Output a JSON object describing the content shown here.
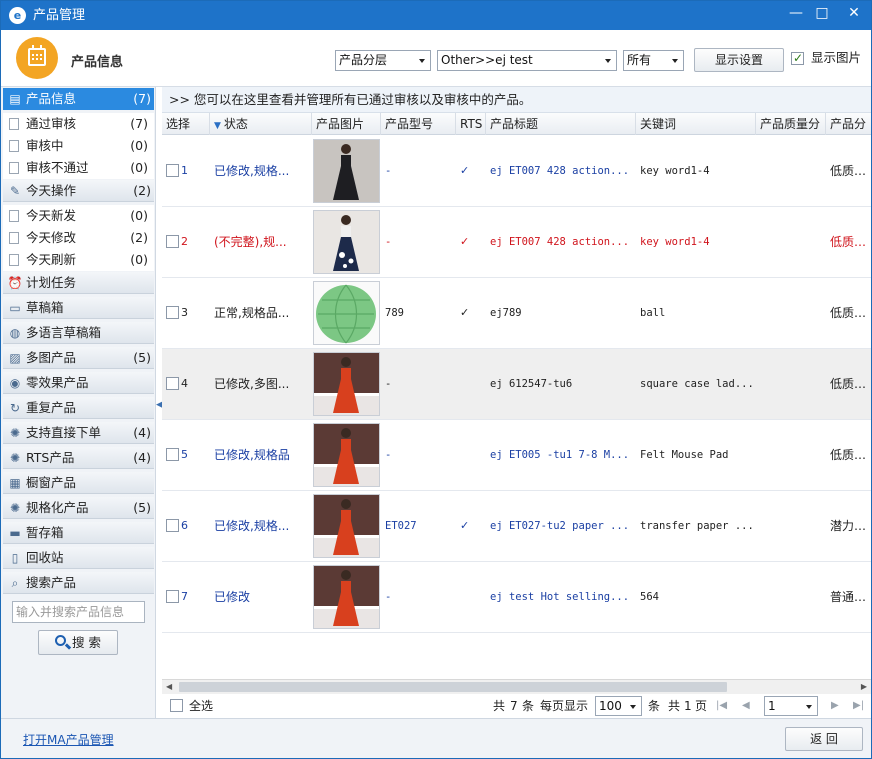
{
  "window": {
    "title": "产品管理",
    "minimize": "—",
    "maximize": "□",
    "close": "✕"
  },
  "header": {
    "title": "产品信息",
    "filter1": "产品分层",
    "filter2": "Other>>ej test",
    "filter3": "所有",
    "display_settings": "显示设置",
    "show_images_label": "显示图片"
  },
  "sidebar": {
    "groups": [
      {
        "label": "产品信息",
        "count": "(7)",
        "icon": "list-icon",
        "active": true
      },
      {
        "label": "今天操作",
        "count": "(2)",
        "icon": "edit-icon"
      },
      {
        "label": "计划任务",
        "count": "",
        "icon": "alarm-clock-icon"
      },
      {
        "label": "草稿箱",
        "count": "",
        "icon": "draft-box-icon"
      },
      {
        "label": "多语言草稿箱",
        "count": "",
        "icon": "globe-icon"
      },
      {
        "label": "多图产品",
        "count": "(5)",
        "icon": "image-icon"
      },
      {
        "label": "零效果产品",
        "count": "",
        "icon": "eye-icon"
      },
      {
        "label": "重复产品",
        "count": "",
        "icon": "repeat-icon"
      },
      {
        "label": "支持直接下单",
        "count": "(4)",
        "icon": "bulb-icon"
      },
      {
        "label": "RTS产品",
        "count": "(4)",
        "icon": "bulb-icon"
      },
      {
        "label": "橱窗产品",
        "count": "",
        "icon": "showcase-icon"
      },
      {
        "label": "规格化产品",
        "count": "(5)",
        "icon": "bulb-icon"
      },
      {
        "label": "暂存箱",
        "count": "",
        "icon": "storage-box-icon"
      },
      {
        "label": "回收站",
        "count": "",
        "icon": "trash-icon"
      },
      {
        "label": "搜索产品",
        "count": "",
        "icon": "search-icon"
      }
    ],
    "sub_product_info": [
      {
        "label": "通过审核",
        "count": "(7)"
      },
      {
        "label": "审核中",
        "count": "(0)"
      },
      {
        "label": "审核不通过",
        "count": "(0)"
      }
    ],
    "sub_today": [
      {
        "label": "今天新发",
        "count": "(0)"
      },
      {
        "label": "今天修改",
        "count": "(2)"
      },
      {
        "label": "今天刷新",
        "count": "(0)"
      }
    ],
    "search_placeholder": "输入并搜索产品信息",
    "search_button": "搜 索"
  },
  "main": {
    "info_text": ">> 您可以在这里查看并管理所有已通过审核以及审核中的产品。",
    "columns": [
      "选择",
      "状态",
      "产品图片",
      "产品型号",
      "RTS",
      "产品标题",
      "关键词",
      "产品质量分",
      "产品分"
    ],
    "rows": [
      {
        "num": "1",
        "status": "已修改,规格...",
        "model": "-",
        "rts": "✓",
        "title": "ej ET007 428 action...",
        "keyword": "key word1-4",
        "quality": "低质产品",
        "color": "#1a3fa3",
        "kwcolor": "#222",
        "img": "dress-black"
      },
      {
        "num": "2",
        "status": "(不完整),规...",
        "model": "-",
        "rts": "✓",
        "title": "ej ET007 428 action...",
        "keyword": "key word1-4",
        "quality": "低质产品",
        "color": "#d0141c",
        "kwcolor": "#d0141c",
        "img": "dress-floral"
      },
      {
        "num": "3",
        "status": "正常,规格品...",
        "model": "789",
        "rts": "✓",
        "title": "ej789",
        "keyword": "ball",
        "quality": "低质产品",
        "color": "#222",
        "kwcolor": "#222",
        "img": "lantern"
      },
      {
        "num": "4",
        "status": "已修改,多图...",
        "model": "-",
        "rts": "",
        "title": "ej 612547-tu6",
        "keyword": "square case lad...",
        "quality": "低质产品",
        "color": "#222",
        "kwcolor": "#222",
        "img": "dress-red"
      },
      {
        "num": "5",
        "status": "已修改,规格品",
        "model": "-",
        "rts": "",
        "title": "ej ET005 -tu1 7-8 M...",
        "keyword": "Felt Mouse Pad",
        "quality": "低质产品",
        "color": "#1a3fa3",
        "kwcolor": "#222",
        "img": "dress-red"
      },
      {
        "num": "6",
        "status": "已修改,规格...",
        "model": "ET027",
        "rts": "✓",
        "title": "ej ET027-tu2 paper ...",
        "keyword": "transfer paper ...",
        "quality": "潜力商品",
        "color": "#1a3fa3",
        "kwcolor": "#222",
        "img": "dress-red"
      },
      {
        "num": "7",
        "status": "已修改",
        "model": "-",
        "rts": "",
        "title": "ej test Hot selling...",
        "keyword": "564",
        "quality": "普通产品",
        "color": "#1a3fa3",
        "kwcolor": "#222",
        "img": "dress-red"
      }
    ]
  },
  "pager": {
    "select_all": "全选",
    "total_prefix": "共",
    "total_count": "7",
    "total_unit": "条",
    "per_page_label": "每页显示",
    "per_page_value": "100",
    "per_page_unit": "条",
    "pages_prefix": "共",
    "pages_count": "1",
    "pages_unit": "页",
    "current_page": "1"
  },
  "footer": {
    "ma_link": "打开MA产品管理",
    "back_button": "返 回"
  },
  "colors": {
    "titlebar": "#1e73c9",
    "active_group": "#2b8ae0",
    "accent_orange": "#f3a524"
  }
}
